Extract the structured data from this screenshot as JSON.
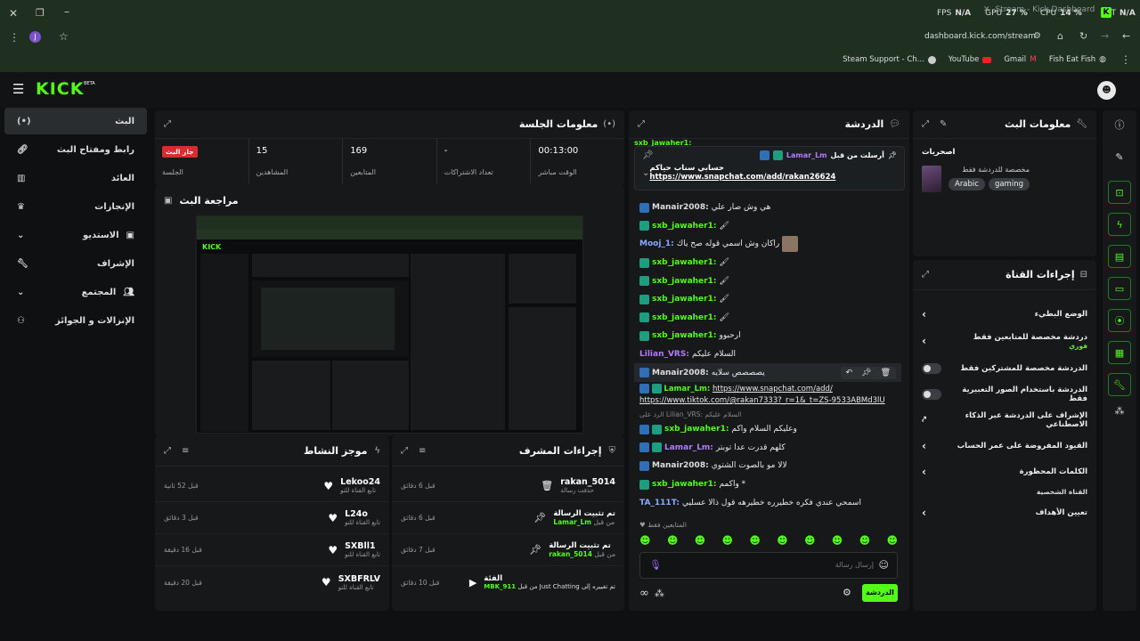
{
  "browser": {
    "tab_title": "Stream - Kick Dashboard",
    "fps_label": "FPS",
    "fps_val": "N/A",
    "gpu_label": "GPU",
    "gpu_val": "27 %",
    "cpu_label": "CPU",
    "cpu_val": "14 %",
    "lat_label": "LAT",
    "lat_val": "N/A",
    "profile_initial": "J",
    "url": "dashboard.kick.com/stream",
    "bookmarks": [
      "Steam Support - Ch...",
      "YouTube",
      "Gmail",
      "Fish Eat Fish"
    ]
  },
  "app": {
    "logo": "KICK",
    "logo_beta": "BETA"
  },
  "sidebar": {
    "items": [
      {
        "label": "البث",
        "icon": "broadcast-icon"
      },
      {
        "label": "رابط ومفتاح البث",
        "icon": "link-icon"
      },
      {
        "label": "العائد",
        "icon": "chart-icon"
      },
      {
        "label": "الإنجازات",
        "icon": "trophy-icon"
      },
      {
        "label": "الاستديو",
        "icon": "studio-icon"
      },
      {
        "label": "الإشراف",
        "icon": "wrench-icon"
      },
      {
        "label": "المجتمع",
        "icon": "community-icon"
      },
      {
        "label": "الإنزالات و الجوائز",
        "icon": "drops-icon"
      }
    ]
  },
  "session": {
    "title": "معلومات الجلسة",
    "live_badge": "جار البث",
    "stats": [
      {
        "value": "",
        "label": "الجلسة"
      },
      {
        "value": "15",
        "label": "المشاهدين"
      },
      {
        "value": "169",
        "label": "المتابعين"
      },
      {
        "value": "-",
        "label": "تعداد الاشتراكات"
      },
      {
        "value": "00:13:00",
        "label": "الوقت مباشر"
      }
    ]
  },
  "preview": {
    "title": "مراجعة البث"
  },
  "activity": {
    "title": "موجز النشاط",
    "items": [
      {
        "user": "Lekoo24",
        "sub": "تابع القناة للتو",
        "time": "قبل 52 ثانية"
      },
      {
        "user": "L24o",
        "sub": "تابع القناة للتو",
        "time": "قبل 3 دقائق"
      },
      {
        "user": "SXBll1",
        "sub": "تابع القناة للتو",
        "time": "قبل 16 دقيقة"
      },
      {
        "user": "SXBFRLV",
        "sub": "تابع القناة للتو",
        "time": "قبل 20 دقيقة"
      }
    ]
  },
  "mod_actions": {
    "title": "إجراءات المشرف",
    "items": [
      {
        "line1": "rakan_5014",
        "line2": "حذفت رسالة",
        "time": "قبل 6 دقائق"
      },
      {
        "line1": "تم تثبيت الرسالة",
        "line2a": "من قبل",
        "line2b": "Lamar_Lm",
        "time": "قبل 6 دقائق"
      },
      {
        "line1": "تم تثبيت الرسالة",
        "line2a": "من قبل",
        "line2b": "rakan_5014",
        "time": "قبل 7 دقائق"
      },
      {
        "line1": "الفئة",
        "line2a": "تم تغييره إلى Just Chatting من قبل",
        "line2b": "MBK_911",
        "time": "قبل 10 دقائق"
      }
    ]
  },
  "chat": {
    "title": "الدردشة",
    "pinned_by_label": "أرسلت من قبل",
    "pinned_user": "Lamar_Lm",
    "pinned_text": "حسابي سناب حياكم",
    "pinned_link": "https://www.snapchat.com/add/rakan26624",
    "hidden_top_user": "sxb_jawaher1:",
    "messages": [
      {
        "user": "Manair2008:",
        "text": "هي وش صار علي"
      },
      {
        "user": "sxb_jawaher1:",
        "text": ""
      },
      {
        "user": "Mooj_1:",
        "text": "راكان وش اسمي قوله صح ياك"
      },
      {
        "user": "sxb_jawaher1:",
        "text": ""
      },
      {
        "user": "sxb_jawaher1:",
        "text": ""
      },
      {
        "user": "sxb_jawaher1:",
        "text": ""
      },
      {
        "user": "sxb_jawaher1:",
        "text": ""
      },
      {
        "user": "sxb_jawaher1:",
        "text": "ارحبوو"
      },
      {
        "user": "Lilian_VRS:",
        "text": "السلام عليكم"
      },
      {
        "user": "Manair2008:",
        "text": "يصصصص سلايه"
      }
    ],
    "link_msg_user": "Lamar_Lm:",
    "link_msg_1": "https://www.snapchat.com/add/",
    "link_msg_2": "https://www.tiktok.com/@rakan7333?_r=1&_t=ZS-9533ABMd3lU",
    "reply_ref": "الرد على Lilian_VRS: السلام عليكم",
    "messages2": [
      {
        "user": "sxb_jawaher1:",
        "text": "وعليكم السلام واكم"
      },
      {
        "user": "Lamar_Lm:",
        "text": "كلهم قدرت عدا توبتر"
      },
      {
        "user": "Manair2008:",
        "text": "لالا مو بالصوت الشتوي"
      },
      {
        "user": "sxb_jawaher1:",
        "text": "واكمم *"
      },
      {
        "user": "TA_111T:",
        "text": "اسمحي عندي فكره خطيرره خطيرهه قول ذالا عسليي"
      }
    ],
    "followers_only": "المتابعين فقط",
    "input_placeholder": "إرسال رسالة",
    "send_label": "الدردشة"
  },
  "stream_info": {
    "title": "معلومات البث",
    "category_label": "اصحريات",
    "desc": "مخصصة للدردشة فقط",
    "tags": [
      "Arabic",
      "gaming"
    ]
  },
  "channel_actions": {
    "title": "إجراءات القناة",
    "rows": [
      {
        "label": "الوضع البطيء",
        "type": "chevron"
      },
      {
        "label": "دردشة مخصصة للمتابعين فقط",
        "sub": "فوري",
        "type": "chevron"
      },
      {
        "label": "الدردشة مخصصة للمشتركين فقط",
        "type": "toggle"
      },
      {
        "label": "الدردشة باستخدام الصور التعبيرية فقط",
        "type": "toggle"
      },
      {
        "label": "الإشراف على الدردشة عبر الذكاء الاصطناعي",
        "type": "ext"
      },
      {
        "label": "القيود المفروضة على عمر الحساب",
        "type": "chevron"
      },
      {
        "label": "الكلمات المحظورة",
        "type": "chevron"
      }
    ],
    "section_label": "القناة الشخصية",
    "goals_label": "تعيين الأهداف"
  },
  "colors": {
    "accent": "#53fc18",
    "live": "#d62e2e",
    "bg": "#0e1011",
    "panel": "#16181a"
  }
}
